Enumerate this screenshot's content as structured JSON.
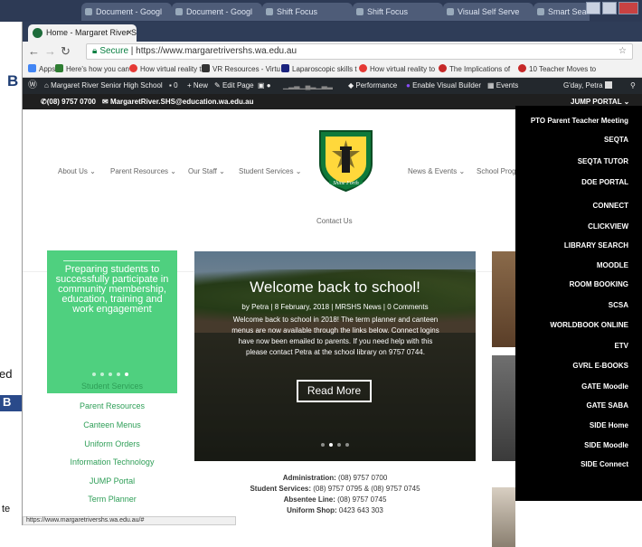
{
  "os_tabs": [
    {
      "label": "Document - Googl"
    },
    {
      "label": "Document - Googl"
    },
    {
      "label": "Shift Focus"
    },
    {
      "label": "Shift Focus"
    },
    {
      "label": "Visual Self Serve"
    },
    {
      "label": "Smart Search"
    }
  ],
  "left_window": {
    "label_1": "B",
    "label_2": "ed",
    "label_3": "B",
    "label_4": "te"
  },
  "browser": {
    "tab_title": "Home - Margaret River S",
    "tab_close": "×",
    "secure_label": "Secure",
    "url": "https://www.margaretrivershs.wa.edu.au",
    "status_url": "https://www.margaretrivershs.wa.edu.au/#"
  },
  "bookmarks": [
    {
      "label": "Apps",
      "color": "#4285f4"
    },
    {
      "label": "Here's how you can",
      "color": "#2e7d32"
    },
    {
      "label": "How virtual reality to",
      "color": "#e53935"
    },
    {
      "label": "VR Resources - Virtu",
      "color": "#333333"
    },
    {
      "label": "Laparoscopic skills t",
      "color": "#1a237e"
    },
    {
      "label": "How virtual reality to",
      "color": "#e53935"
    },
    {
      "label": "The Implications of",
      "color": "#c62828"
    },
    {
      "label": "10 Teacher Moves to",
      "color": "#c62828"
    }
  ],
  "wp_admin": {
    "site_name": "Margaret River Senior High School",
    "comments": "0",
    "new_label": "+ New",
    "edit_label": "Edit Page",
    "performance": "Performance",
    "visual_builder": "Enable Visual Builder",
    "events": "Events",
    "greeting": "G'day, Petra"
  },
  "topbar": {
    "phone": "(08) 9757 0700",
    "email": "MargaretRiver.SHS@education.wa.edu.au",
    "jump_portal": "JUMP PORTAL"
  },
  "menu": {
    "about": "About Us",
    "parent": "Parent Resources",
    "staff": "Our Staff",
    "student": "Student Services",
    "news": "News & Events",
    "school": "School Prog",
    "contact": "Contact Us"
  },
  "logo": {
    "ring_text": "MARGARET RIVER SENIOR HIGH SCHOOL",
    "motto": "Shine Forth"
  },
  "jump_portal_items": [
    "PTO Parent Teacher Meeting",
    "SEQTA",
    "SEQTA TUTOR",
    "DOE PORTAL",
    "CONNECT",
    "CLICKVIEW",
    "LIBRARY SEARCH",
    "MOODLE",
    "ROOM BOOKING",
    "SCSA",
    "WORLDBOOK ONLINE",
    "ETV",
    "GVRL E-BOOKS",
    "GATE Moodle",
    "GATE SABA",
    "SIDE Home",
    "SIDE Moodle",
    "SIDE Connect"
  ],
  "green_box": {
    "text": "Preparing students to successfully participate in community membership, education, training and work engagement",
    "active_dot": 4
  },
  "left_links": [
    "Student Services",
    "Parent Resources",
    "Canteen Menus",
    "Uniform Orders",
    "Information Technology",
    "JUMP Portal",
    "Term Planner"
  ],
  "slide": {
    "title": "Welcome back to school!",
    "meta": "by Petra | 8 February, 2018 | MRSHS News | 0 Comments",
    "body": "Welcome back to school in 2018! The term planner and canteen menus are now available through the links below. Connect logins have now been emailed to parents. If you need help with this please contact Petra at the school library on 9757 0744.",
    "button": "Read More",
    "active_dot": 1
  },
  "contact": {
    "admin_label": "Administration:",
    "admin_value": "(08) 9757 0700",
    "student_label": "Student Services:",
    "student_value": "(08) 9757 0795 & (08) 9757 0745",
    "absentee_label": "Absentee Line:",
    "absentee_value": "(08) 9757 0745",
    "uniform_label": "Uniform Shop:",
    "uniform_value": "0423 643 303"
  },
  "colors": {
    "green": "#4fd07f",
    "link_green": "#2e9e57",
    "dropdown_bg": "#000000",
    "wp_bar": "#23282d",
    "topbar": "#1f1f1f"
  }
}
